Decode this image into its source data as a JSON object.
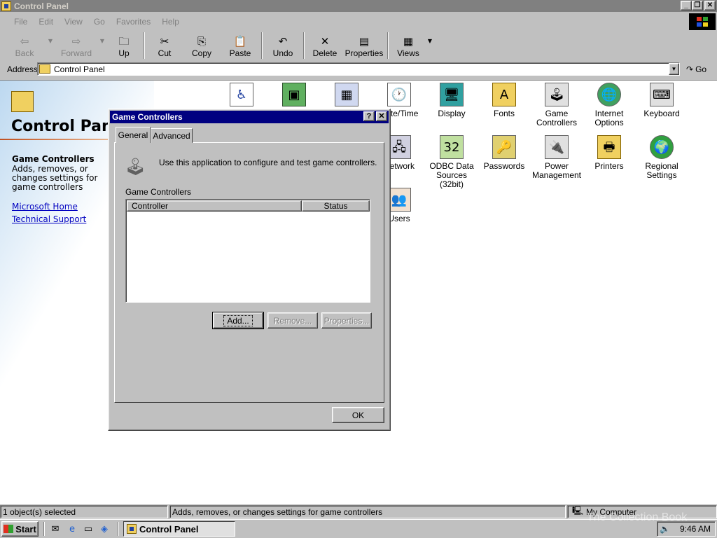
{
  "window": {
    "title": "Control Panel"
  },
  "menu": {
    "file": "File",
    "edit": "Edit",
    "view": "View",
    "go": "Go",
    "favorites": "Favorites",
    "help": "Help"
  },
  "toolbar": {
    "back": "Back",
    "forward": "Forward",
    "up": "Up",
    "cut": "Cut",
    "copy": "Copy",
    "paste": "Paste",
    "undo": "Undo",
    "delete": "Delete",
    "properties": "Properties",
    "views": "Views"
  },
  "address": {
    "label": "Address",
    "value": "Control Panel",
    "go": "Go"
  },
  "leftpane": {
    "title": "Control Panel",
    "selected_name": "Game Controllers",
    "selected_desc": "Adds, removes, or changes settings for game controllers",
    "link1": "Microsoft Home",
    "link2": "Technical Support"
  },
  "icons": {
    "datetime": "Date/Time",
    "display": "Display",
    "fonts": "Fonts",
    "game": "Game Controllers",
    "internet": "Internet Options",
    "keyboard": "Keyboard",
    "network": "Network",
    "odbc": "ODBC Data Sources (32bit)",
    "passwords": "Passwords",
    "power": "Power Management",
    "printers": "Printers",
    "regional": "Regional Settings",
    "users": "Users"
  },
  "dialog": {
    "title": "Game Controllers",
    "tab_general": "General",
    "tab_advanced": "Advanced",
    "intro": "Use this application to configure and test game controllers.",
    "group_label": "Game Controllers",
    "col_controller": "Controller",
    "col_status": "Status",
    "add": "Add...",
    "remove": "Remove...",
    "properties": "Properties...",
    "ok": "OK"
  },
  "statusbar": {
    "selected": "1 object(s) selected",
    "description": "Adds, removes, or changes settings for game controllers",
    "zone": "My Computer"
  },
  "taskbar": {
    "start": "Start",
    "task": "Control Panel",
    "clock": "9:46 AM"
  },
  "watermark": "The Collection Book"
}
